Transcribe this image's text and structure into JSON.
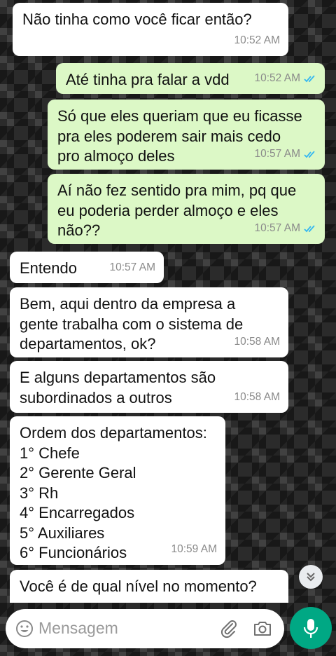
{
  "messages": [
    {
      "direction": "in",
      "text": "Não tinha como você ficar então?",
      "time": "10:52 AM"
    },
    {
      "direction": "out",
      "text": "Até tinha pra falar a vdd",
      "time": "10:52 AM",
      "read": true
    },
    {
      "direction": "out",
      "text": "Só que eles queriam que eu ficasse\npra eles poderem sair mais cedo\npro almoço deles",
      "time": "10:57 AM",
      "read": true
    },
    {
      "direction": "out",
      "text": "Aí não fez sentido pra mim, pq que\neu poderia perder almoço e eles\nnão??",
      "time": "10:57 AM",
      "read": true
    },
    {
      "direction": "in",
      "text": "Entendo",
      "time": "10:57 AM"
    },
    {
      "direction": "in",
      "text": "Bem, aqui dentro da empresa a\ngente trabalha com o sistema de\ndepartamentos, ok?",
      "time": "10:58 AM"
    },
    {
      "direction": "in",
      "text": "E alguns departamentos são\nsubordinados a outros",
      "time": "10:58 AM"
    },
    {
      "direction": "in",
      "text": "Ordem dos departamentos:\n1° Chefe\n2° Gerente Geral\n3° Rh\n4° Encarregados\n5° Auxiliares\n6° Funcionários",
      "time": "10:59 AM"
    },
    {
      "direction": "in",
      "text": "Você é de qual nível no momento?",
      "time": ""
    }
  ],
  "composer": {
    "placeholder": "Mensagem",
    "icons": [
      "emoji-icon",
      "attach-icon",
      "camera-icon",
      "mic-icon"
    ]
  },
  "scroll_down_icon": "double-chevron-down-icon",
  "colors": {
    "incoming": "#ffffff",
    "outgoing": "#dcf8c6",
    "read_ticks": "#34b7f1",
    "accent": "#00a884"
  }
}
